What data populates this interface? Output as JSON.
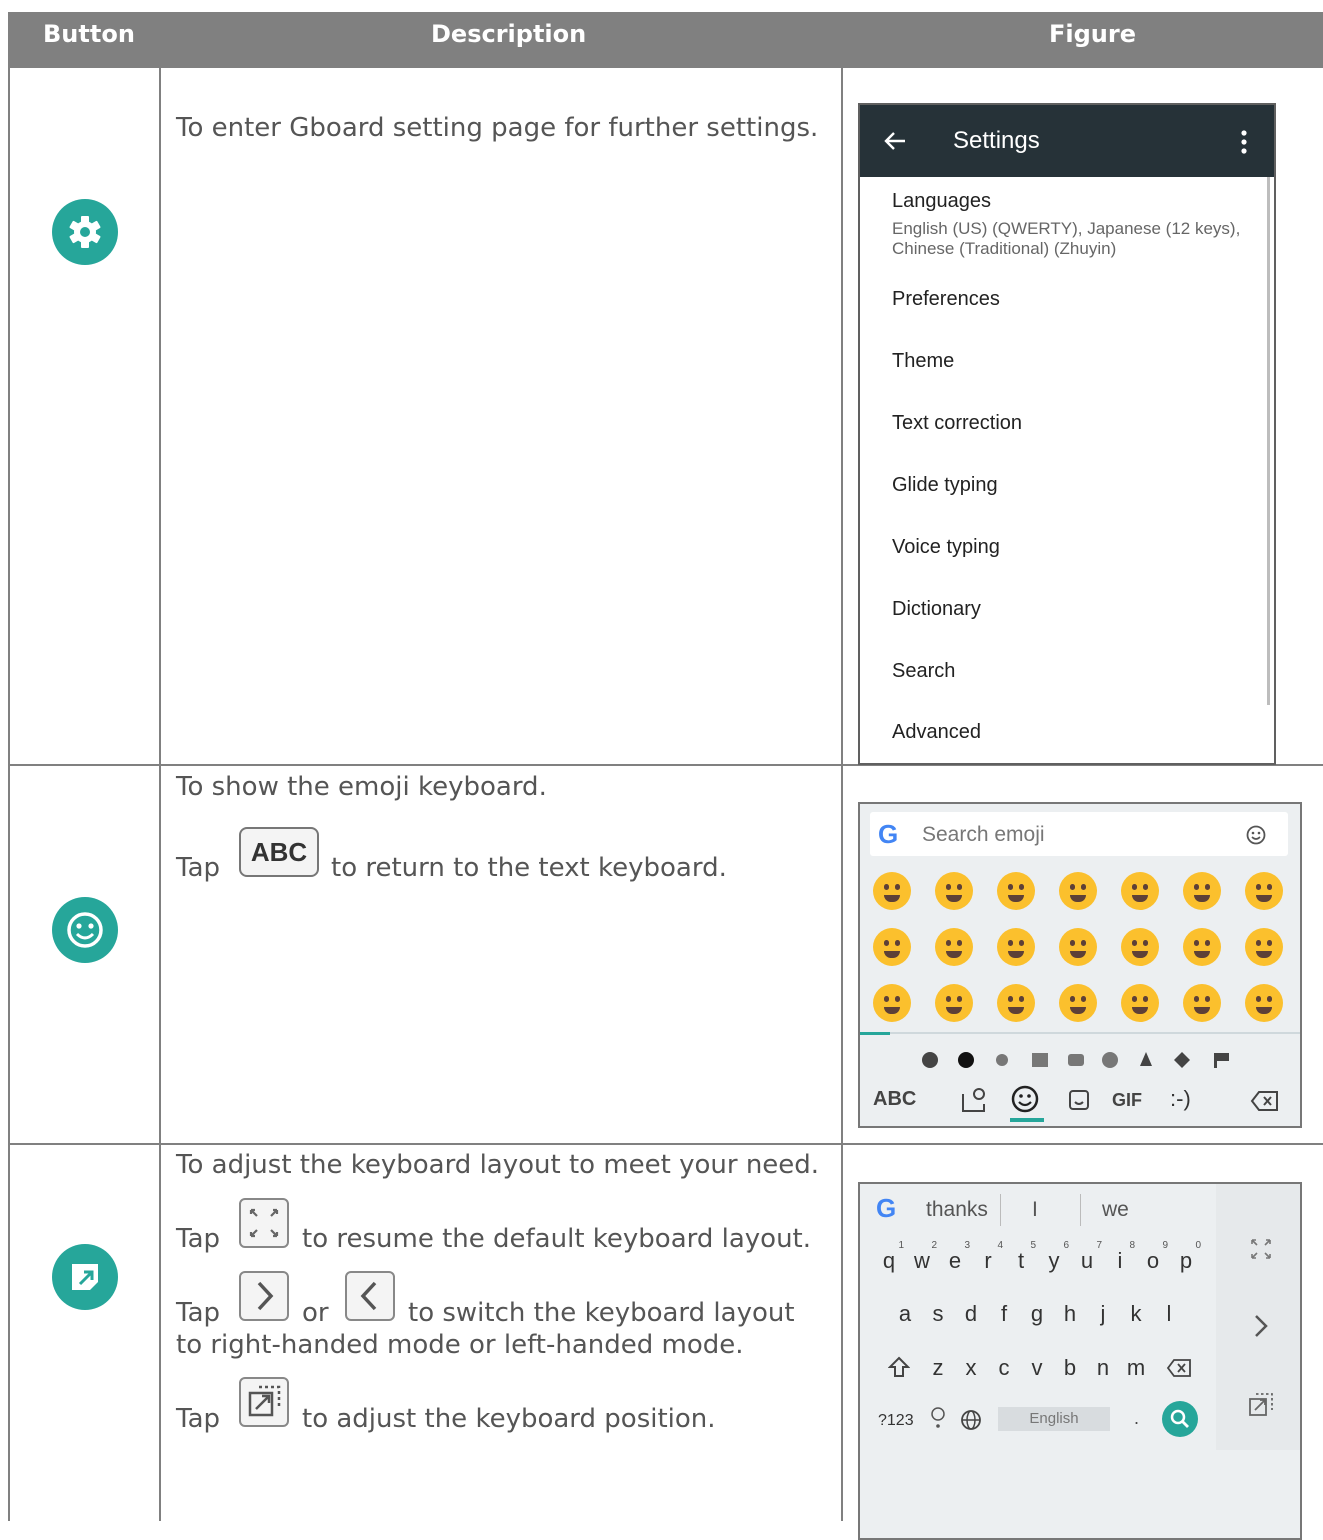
{
  "table": {
    "headers": [
      "Button",
      "Description",
      "Figure"
    ]
  },
  "rows": [
    {
      "desc": [
        "To enter Gboard setting page for further settings."
      ]
    },
    {
      "desc": [
        "To show the emoji keyboard.",
        "Tap",
        "ABC",
        "to return to the text keyboard."
      ]
    },
    {
      "desc": [
        "To adjust the keyboard layout to meet your need.",
        "Tap",
        "to resume the default keyboard layout.",
        "Tap",
        "or",
        "to switch the keyboard layout",
        "to right-handed mode or left-handed mode.",
        "Tap",
        "to adjust the keyboard position."
      ]
    }
  ],
  "settings": {
    "title": "Settings",
    "items": [
      "Languages",
      "Preferences",
      "Theme",
      "Text correction",
      "Glide typing",
      "Voice typing",
      "Dictionary",
      "Search",
      "Advanced"
    ],
    "languages_sub": [
      "English (US) (QWERTY), Japanese (12 keys),",
      "Chinese (Traditional) (Zhuyin)"
    ]
  },
  "emoji_kb": {
    "search_placeholder": "Search emoji",
    "bottom": [
      "ABC",
      "GIF",
      ":-)"
    ]
  },
  "keyboard": {
    "suggestions": [
      "thanks",
      "I",
      "we"
    ],
    "row1": [
      "q",
      "w",
      "e",
      "r",
      "t",
      "y",
      "u",
      "i",
      "o",
      "p"
    ],
    "row1_num": [
      "1",
      "2",
      "3",
      "4",
      "5",
      "6",
      "7",
      "8",
      "9",
      "0"
    ],
    "row2": [
      "a",
      "s",
      "d",
      "f",
      "g",
      "h",
      "j",
      "k",
      "l"
    ],
    "row3": [
      "z",
      "x",
      "c",
      "v",
      "b",
      "n",
      "m"
    ],
    "sym": "?123",
    "space": "English",
    "period": "."
  },
  "colors": {
    "accent": "#26a69a",
    "header": "#808080",
    "appbar": "#263238"
  }
}
